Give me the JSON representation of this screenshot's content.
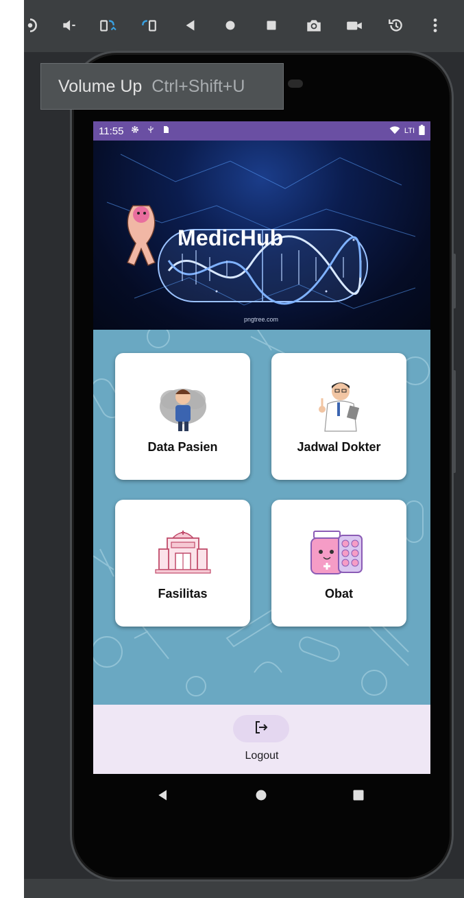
{
  "toolbar": {
    "icons": [
      "power-icon",
      "volume-down-icon",
      "rotate-left-icon",
      "rotate-right-icon",
      "back-icon",
      "home-icon",
      "overview-icon",
      "screenshot-icon",
      "screen-record-icon",
      "snapshots-icon",
      "more-icon"
    ]
  },
  "tooltip": {
    "label": "Volume Up",
    "shortcut": "Ctrl+Shift+U"
  },
  "status_bar": {
    "time": "11:55",
    "network": "LTI"
  },
  "banner": {
    "title": "MedicHub",
    "credit": "pngtree.com"
  },
  "menu": {
    "items": [
      {
        "label": "Data Pasien",
        "icon": "patient-illustration"
      },
      {
        "label": "Jadwal Dokter",
        "icon": "doctor-illustration"
      },
      {
        "label": "Fasilitas",
        "icon": "hospital-illustration"
      },
      {
        "label": "Obat",
        "icon": "medicine-illustration"
      }
    ]
  },
  "bottom_nav": {
    "logout_label": "Logout"
  },
  "colors": {
    "status_bar": "#6a4fa3",
    "main_background": "#6aa8c2",
    "bottom_nav": "#efe7f5",
    "banner": "#0b1d4f"
  }
}
